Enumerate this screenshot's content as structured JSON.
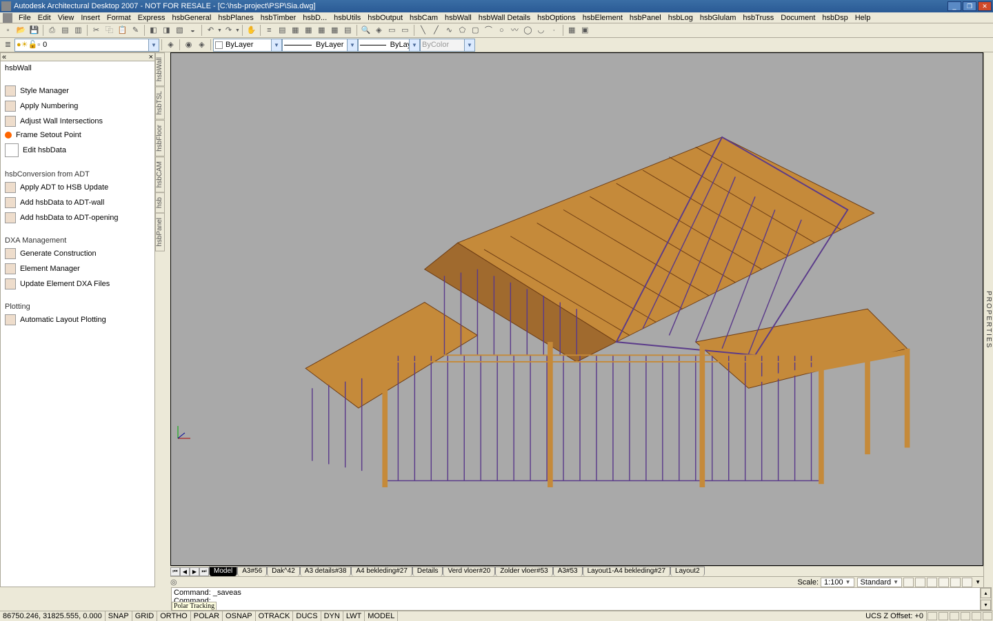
{
  "title": "Autodesk Architectural Desktop 2007 - NOT FOR RESALE - [C:\\hsb-project\\PSP\\Sia.dwg]",
  "menus": [
    "File",
    "Edit",
    "View",
    "Insert",
    "Format",
    "Express",
    "hsbGeneral",
    "hsbPlanes",
    "hsbTimber",
    "hsbD...",
    "hsbUtils",
    "hsbOutput",
    "hsbCam",
    "hsbWall",
    "hsbWall Details",
    "hsbOptions",
    "hsbElement",
    "hsbPanel",
    "hsbLog",
    "hsbGlulam",
    "hsbTruss",
    "Document",
    "hsbDsp",
    "Help"
  ],
  "layer_combo": "0",
  "props": {
    "color": "ByLayer",
    "ltype": "ByLayer",
    "lweight": "ByLayer",
    "plot": "ByColor"
  },
  "palette": {
    "title": "hsbWall",
    "sections": [
      {
        "header": null,
        "items": [
          "Style Manager",
          "Apply Numbering",
          "Adjust Wall Intersections",
          "Frame Setout Point",
          "Edit hsbData"
        ]
      },
      {
        "header": "hsbConversion from ADT",
        "items": [
          "Apply ADT to HSB Update",
          "Add hsbData to ADT-wall",
          "Add hsbData to ADT-opening"
        ]
      },
      {
        "header": "DXA Management",
        "items": [
          "Generate Construction",
          "Element Manager",
          "Update Element DXA Files"
        ]
      },
      {
        "header": "Plotting",
        "items": [
          "Automatic Layout Plotting"
        ]
      }
    ]
  },
  "vtabs": [
    "hsbWall",
    "hsbTSL",
    "hsbFloor",
    "hsbCAM",
    "hsb",
    "hsbPanel"
  ],
  "layout_tabs": [
    "Model",
    "A3#56",
    "Dak^42",
    "A3 details#38",
    "A4 bekleding#27",
    "Details",
    "Verd vloer#20",
    "Zolder vloer#53",
    "A3#53",
    "Layout1-A4 bekleding#27",
    "Layout2"
  ],
  "scale": {
    "label": "Scale:",
    "value": "1:100",
    "anno": "Standard"
  },
  "command": {
    "line1": "Command: _saveas",
    "line2": "Command:",
    "tip": "Polar Tracking"
  },
  "status": {
    "coords": "86750.246, 31825.555, 0.000",
    "toggles": [
      "SNAP",
      "GRID",
      "ORTHO",
      "POLAR",
      "OSNAP",
      "OTRACK",
      "DUCS",
      "DYN",
      "LWT",
      "MODEL"
    ],
    "ucs": "UCS Z Offset:",
    "ucs_val": "+0"
  },
  "properties_label": "PROPERTIES"
}
